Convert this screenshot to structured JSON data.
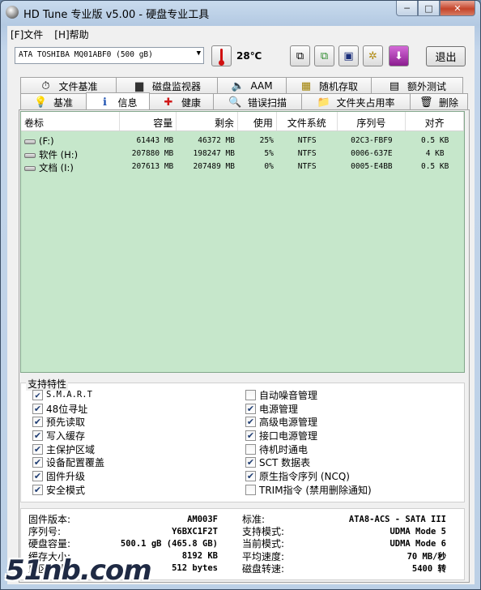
{
  "window": {
    "title": "HD Tune 专业版 v5.00 - 硬盘专业工具",
    "min_label": "─",
    "max_label": "□",
    "close_label": "✕"
  },
  "menu": [
    {
      "label": "[F]文件"
    },
    {
      "label": "[H]帮助"
    }
  ],
  "toolbar": {
    "drive": "ATA     TOSHIBA MQ01ABF0 (500 gB)",
    "temperature": "28℃",
    "exit_label": "退出"
  },
  "tabs_top": [
    {
      "label": "文件基准",
      "icon": "file-benchmark-icon",
      "glyph": "⏱"
    },
    {
      "label": "磁盘监视器",
      "icon": "disk-monitor-icon",
      "glyph": "▆"
    },
    {
      "label": "AAM",
      "icon": "speaker-icon",
      "glyph": "🔈"
    },
    {
      "label": "随机存取",
      "icon": "random-access-icon",
      "glyph": "▦"
    },
    {
      "label": "额外测试",
      "icon": "extra-tests-icon",
      "glyph": "▤"
    }
  ],
  "tabs_bottom": [
    {
      "label": "基准",
      "icon": "lightbulb-icon",
      "glyph": "💡"
    },
    {
      "label": "信息",
      "icon": "info-icon",
      "glyph": "ℹ"
    },
    {
      "label": "健康",
      "icon": "health-cross-icon",
      "glyph": "✚"
    },
    {
      "label": "错误扫描",
      "icon": "magnifier-icon",
      "glyph": "🔍"
    },
    {
      "label": "文件夹占用率",
      "icon": "folder-icon",
      "glyph": "📁"
    },
    {
      "label": "删除",
      "icon": "trash-icon",
      "glyph": "🗑"
    }
  ],
  "volumes": {
    "headers": [
      "卷标",
      "容量",
      "剩余",
      "使用",
      "文件系统",
      "序列号",
      "对齐"
    ],
    "rows": [
      {
        "label": "(F:)",
        "capacity": "61443 MB",
        "free": "46372 MB",
        "used": "25%",
        "fs": "NTFS",
        "serial": "02C3-FBF9",
        "align": "0.5 KB"
      },
      {
        "label": "软件 (H:)",
        "capacity": "207880 MB",
        "free": "198247 MB",
        "used": "5%",
        "fs": "NTFS",
        "serial": "0006-637E",
        "align": "4 KB"
      },
      {
        "label": "文档 (I:)",
        "capacity": "207613 MB",
        "free": "207489 MB",
        "used": "0%",
        "fs": "NTFS",
        "serial": "0005-E4BB",
        "align": "0.5 KB"
      }
    ]
  },
  "features": {
    "title": "支持特性",
    "left": [
      {
        "label": "S.M.A.R.T",
        "checked": true,
        "mono": true
      },
      {
        "label": "48位寻址",
        "checked": true,
        "mono": false
      },
      {
        "label": "预先读取",
        "checked": true,
        "mono": false
      },
      {
        "label": "写入缓存",
        "checked": true,
        "mono": false
      },
      {
        "label": "主保护区域",
        "checked": true,
        "mono": false
      },
      {
        "label": "设备配置覆盖",
        "checked": true,
        "mono": false
      },
      {
        "label": "固件升级",
        "checked": true,
        "mono": false
      },
      {
        "label": "安全模式",
        "checked": true,
        "mono": false
      }
    ],
    "right": [
      {
        "label": "自动噪音管理",
        "checked": false,
        "mono": false
      },
      {
        "label": "电源管理",
        "checked": true,
        "mono": false
      },
      {
        "label": "高级电源管理",
        "checked": true,
        "mono": false
      },
      {
        "label": "接口电源管理",
        "checked": true,
        "mono": false
      },
      {
        "label": "待机时通电",
        "checked": false,
        "mono": false
      },
      {
        "label": "SCT 数据表",
        "checked": true,
        "mono": false
      },
      {
        "label": "原生指令序列 (NCQ)",
        "checked": true,
        "mono": false
      },
      {
        "label": "TRIM指令 (禁用删除通知)",
        "checked": false,
        "mono": false
      }
    ]
  },
  "details": {
    "left": [
      {
        "key": "固件版本:",
        "value": "AM003F"
      },
      {
        "key": "序列号:",
        "value": "Y6BXC1F2T"
      },
      {
        "key": "硬盘容量:",
        "value": "500.1 gB (465.8 GB)"
      },
      {
        "key": "缓存大小:",
        "value": "8192 KB"
      },
      {
        "key": "扇区大小:",
        "value": "512 bytes"
      }
    ],
    "right": [
      {
        "key": "标准:",
        "value": "ATA8-ACS - SATA III"
      },
      {
        "key": "支持模式:",
        "value": "UDMA Mode 5"
      },
      {
        "key": "当前模式:",
        "value": "UDMA Mode 6"
      },
      {
        "key": "平均速度:",
        "value": "70 MB/秒"
      },
      {
        "key": "磁盘转速:",
        "value": "5400 转"
      }
    ]
  },
  "watermark": "51nb.com"
}
